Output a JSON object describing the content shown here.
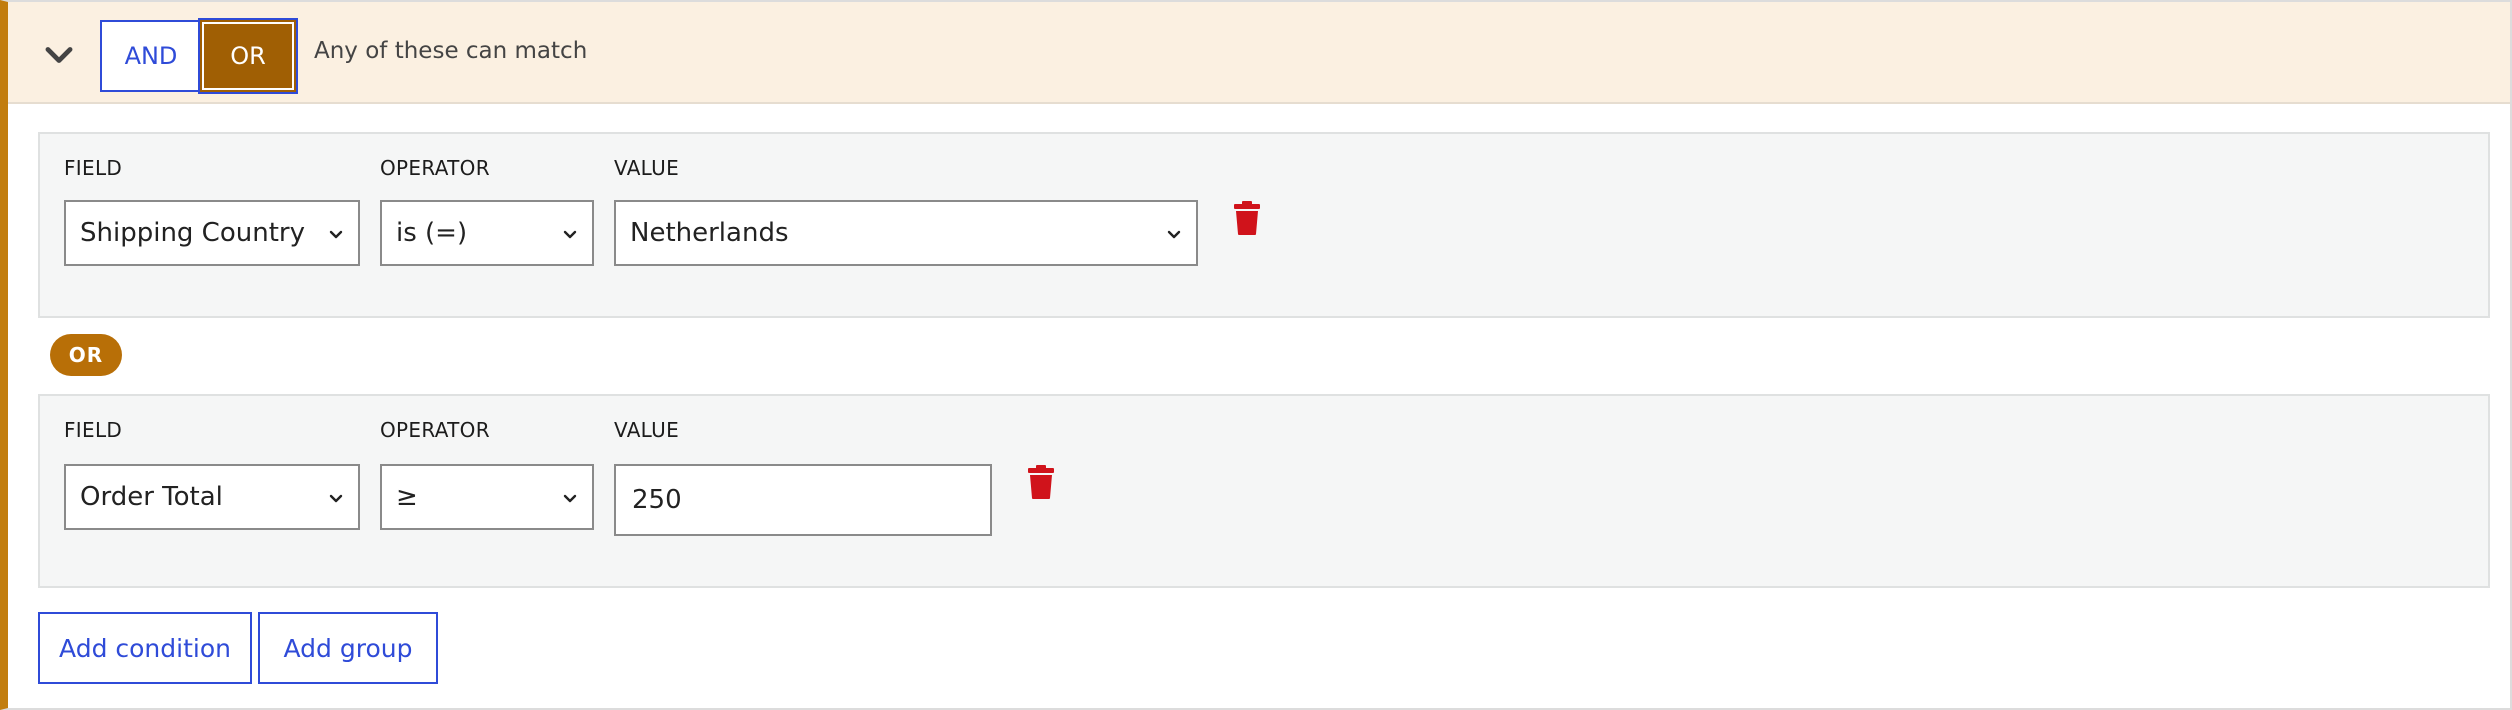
{
  "header": {
    "and_label": "AND",
    "or_label": "OR",
    "hint": "Any of these can match",
    "active_operator": "OR"
  },
  "conditions": [
    {
      "field_label": "FIELD",
      "operator_label": "OPERATOR",
      "value_label": "VALUE",
      "field": "Shipping Country",
      "operator": "is (=)",
      "value": "Netherlands",
      "value_type": "select"
    },
    {
      "field_label": "FIELD",
      "operator_label": "OPERATOR",
      "value_label": "VALUE",
      "field": "Order Total",
      "operator": "≥",
      "value": "250",
      "value_type": "text"
    }
  ],
  "connector": "OR",
  "footer": {
    "add_condition": "Add condition",
    "add_group": "Add group"
  },
  "colors": {
    "accent_orange": "#c27d0e",
    "or_active": "#a05f04",
    "link_blue": "#2f4bd8",
    "danger_red": "#d0131b",
    "header_bg": "#fbf0e1"
  },
  "icons": {
    "collapse": "chevron-down-icon",
    "caret": "chevron-down-icon",
    "delete": "trash-icon"
  }
}
